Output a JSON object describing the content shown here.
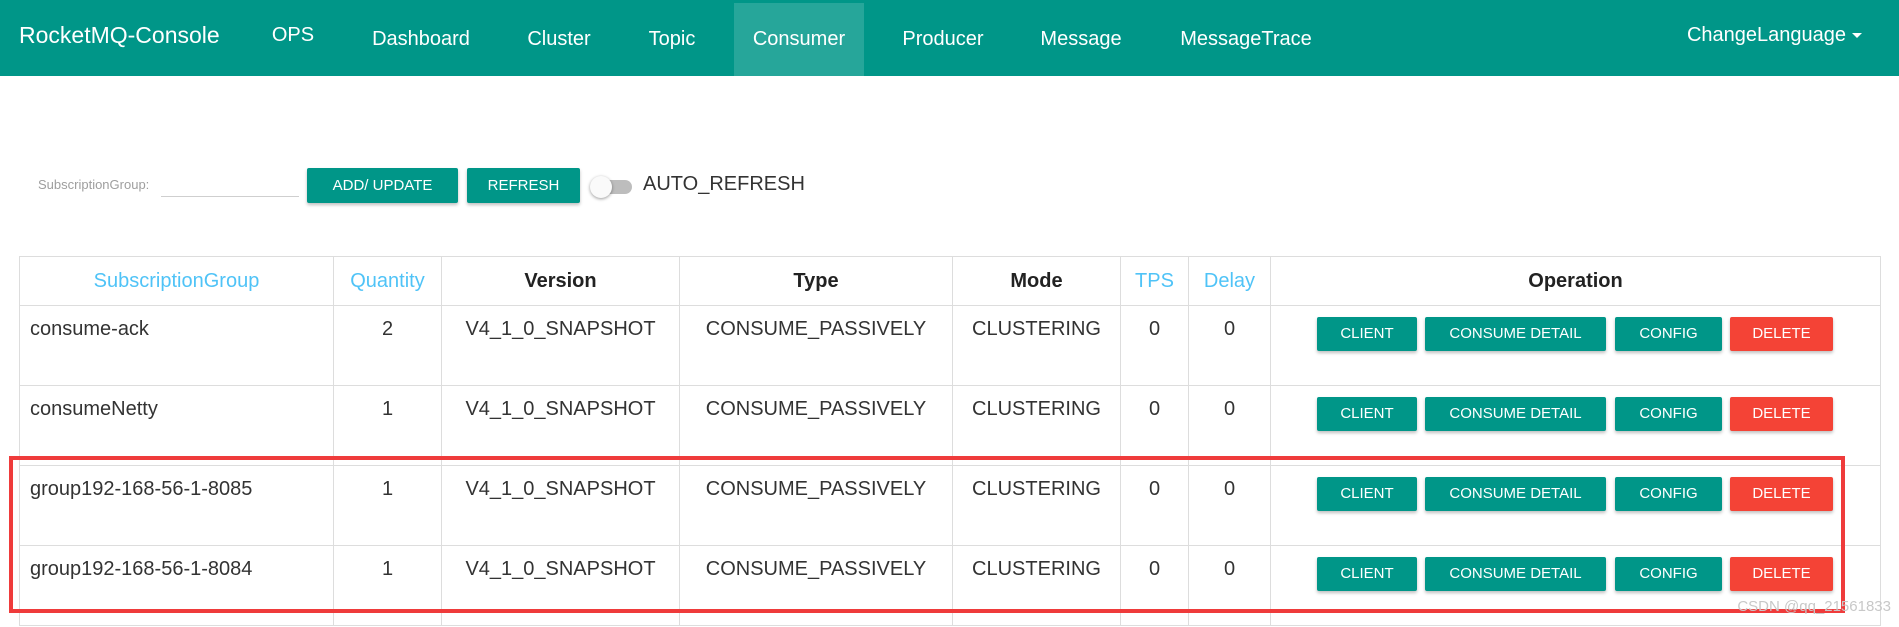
{
  "navbar": {
    "brand": "RocketMQ-Console",
    "items": [
      "OPS",
      "Dashboard",
      "Cluster",
      "Topic",
      "Consumer",
      "Producer",
      "Message",
      "MessageTrace"
    ],
    "active": "Consumer",
    "language": "ChangeLanguage",
    "color": "#009688"
  },
  "toolbar": {
    "label": "SubscriptionGroup:",
    "input_value": "",
    "add_update": "ADD/ UPDATE",
    "refresh": "REFRESH",
    "auto_refresh_label": "AUTO_REFRESH",
    "auto_refresh_on": false
  },
  "table": {
    "headers": [
      "SubscriptionGroup",
      "Quantity",
      "Version",
      "Type",
      "Mode",
      "TPS",
      "Delay",
      "Operation"
    ],
    "rows": [
      {
        "group": "consume-ack",
        "quantity": "2",
        "version": "V4_1_0_SNAPSHOT",
        "type": "CONSUME_PASSIVELY",
        "mode": "CLUSTERING",
        "tps": "0",
        "delay": "0"
      },
      {
        "group": "consumeNetty",
        "quantity": "1",
        "version": "V4_1_0_SNAPSHOT",
        "type": "CONSUME_PASSIVELY",
        "mode": "CLUSTERING",
        "tps": "0",
        "delay": "0"
      },
      {
        "group": "group192-168-56-1-8085",
        "quantity": "1",
        "version": "V4_1_0_SNAPSHOT",
        "type": "CONSUME_PASSIVELY",
        "mode": "CLUSTERING",
        "tps": "0",
        "delay": "0"
      },
      {
        "group": "group192-168-56-1-8084",
        "quantity": "1",
        "version": "V4_1_0_SNAPSHOT",
        "type": "CONSUME_PASSIVELY",
        "mode": "CLUSTERING",
        "tps": "0",
        "delay": "0"
      }
    ],
    "operations": {
      "client": "CLIENT",
      "consume_detail": "CONSUME DETAIL",
      "config": "CONFIG",
      "delete": "DELETE"
    }
  },
  "watermark": "CSDN @qq_21561833",
  "colors": {
    "primary": "#009688",
    "danger": "#f44336",
    "sortable_header": "#4fc3f7",
    "highlight": "#ef3b3b"
  }
}
